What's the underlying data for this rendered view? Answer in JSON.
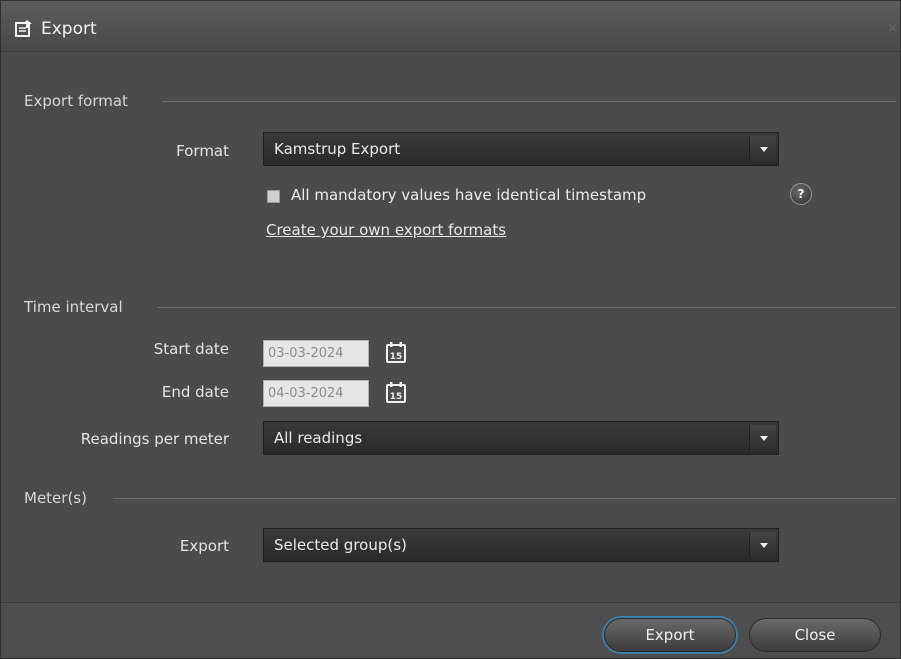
{
  "window": {
    "title": "Export",
    "close_glyph": "×"
  },
  "sections": {
    "export_format": "Export format",
    "time_interval": "Time interval",
    "meters": "Meter(s)"
  },
  "format": {
    "label": "Format",
    "selected": "Kamstrup Export",
    "checkbox_label": "All mandatory values have identical timestamp",
    "checkbox_checked": false,
    "help_glyph": "?",
    "link_text": "Create your own export formats"
  },
  "time_interval": {
    "start_label": "Start date",
    "start_value": "03-03-2024",
    "end_label": "End date",
    "end_value": "04-03-2024",
    "calendar_day": "15",
    "readings_label": "Readings per meter",
    "readings_selected": "All readings"
  },
  "meters": {
    "label": "Export",
    "selected": "Selected group(s)"
  },
  "buttons": {
    "export": "Export",
    "close": "Close"
  },
  "icons": {
    "title": "export-icon",
    "help": "help-icon",
    "calendar": "calendar-icon",
    "dropdown": "chevron-down-icon"
  },
  "colors": {
    "focus_ring": "#3d7fa8",
    "background": "#4b4b4b"
  }
}
